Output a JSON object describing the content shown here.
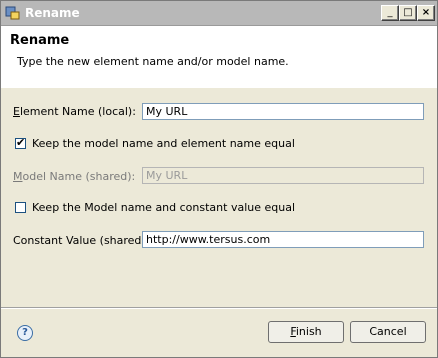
{
  "window": {
    "title": "Rename",
    "icon": "rename-dialog-icon",
    "controls": {
      "minimize": "_",
      "maximize": "□",
      "close": "×"
    }
  },
  "header": {
    "title": "Rename",
    "description": "Type the new element name and/or model name."
  },
  "form": {
    "element_name": {
      "label_underline": "E",
      "label_rest": "lement Name (local):",
      "value": "My URL"
    },
    "keep_equal": {
      "label": "Keep the model name and element name equal",
      "checked": true
    },
    "model_name": {
      "label_underline": "M",
      "label_rest": "odel Name (shared):",
      "value": "My URL",
      "disabled": true
    },
    "keep_constant": {
      "label": "Keep the Model name and constant value equal",
      "checked": false
    },
    "constant_value": {
      "label": "Constant Value (shared):",
      "value": "http://www.tersus.com"
    }
  },
  "buttons": {
    "finish_underline": "F",
    "finish_rest": "inish",
    "cancel": "Cancel",
    "help": "?"
  }
}
